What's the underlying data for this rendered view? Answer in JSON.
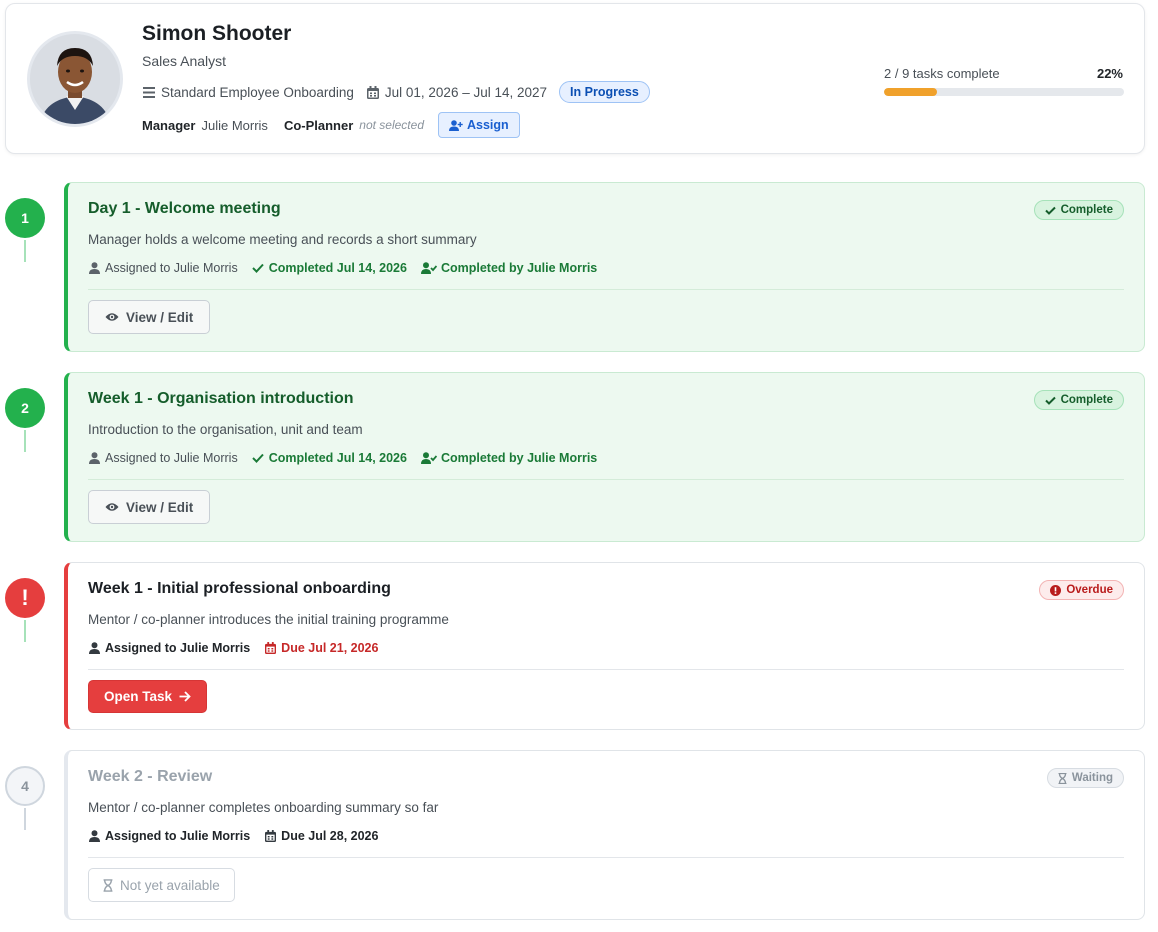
{
  "employee": {
    "name": "Simon Shooter",
    "role": "Sales Analyst",
    "plan": "Standard Employee Onboarding",
    "date_range": "Jul 01, 2026 – Jul 14, 2027",
    "status": "In Progress",
    "manager_label": "Manager",
    "manager": "Julie Morris",
    "coplanner_label": "Co-Planner",
    "coplanner": "not selected",
    "assign_label": "Assign"
  },
  "progress": {
    "text": "2 / 9 tasks complete",
    "percent_label": "22%",
    "fraction": 0.22
  },
  "tasks": [
    {
      "number": "1",
      "title": "Day 1 - Welcome meeting",
      "description": "Manager holds a welcome meeting and records a short summary",
      "assigned": "Assigned to Julie Morris",
      "completed": "Completed Jul 14, 2026",
      "completed_by": "Completed by Julie Morris",
      "status": "Complete",
      "action": "View / Edit"
    },
    {
      "number": "2",
      "title": "Week 1 - Organisation introduction",
      "description": "Introduction to the organisation, unit and team",
      "assigned": "Assigned to Julie Morris",
      "completed": "Completed Jul 14, 2026",
      "completed_by": "Completed by Julie Morris",
      "status": "Complete",
      "action": "View / Edit"
    },
    {
      "number": "!",
      "title": "Week 1 - Initial professional onboarding",
      "description": "Mentor / co-planner introduces the initial training programme",
      "assigned": "Assigned to Julie Morris",
      "due": "Due Jul 21, 2026",
      "status": "Overdue",
      "action": "Open Task"
    },
    {
      "number": "4",
      "title": "Week 2 - Review",
      "description": "Mentor / co-planner completes onboarding summary so far",
      "assigned": "Assigned to Julie Morris",
      "due": "Due Jul 28, 2026",
      "status": "Waiting",
      "action": "Not yet available"
    }
  ],
  "colors": {
    "complete": "#23b14d",
    "overdue": "#e53e3e",
    "progress": "#f0a12b",
    "accent": "#1a5fd0"
  }
}
